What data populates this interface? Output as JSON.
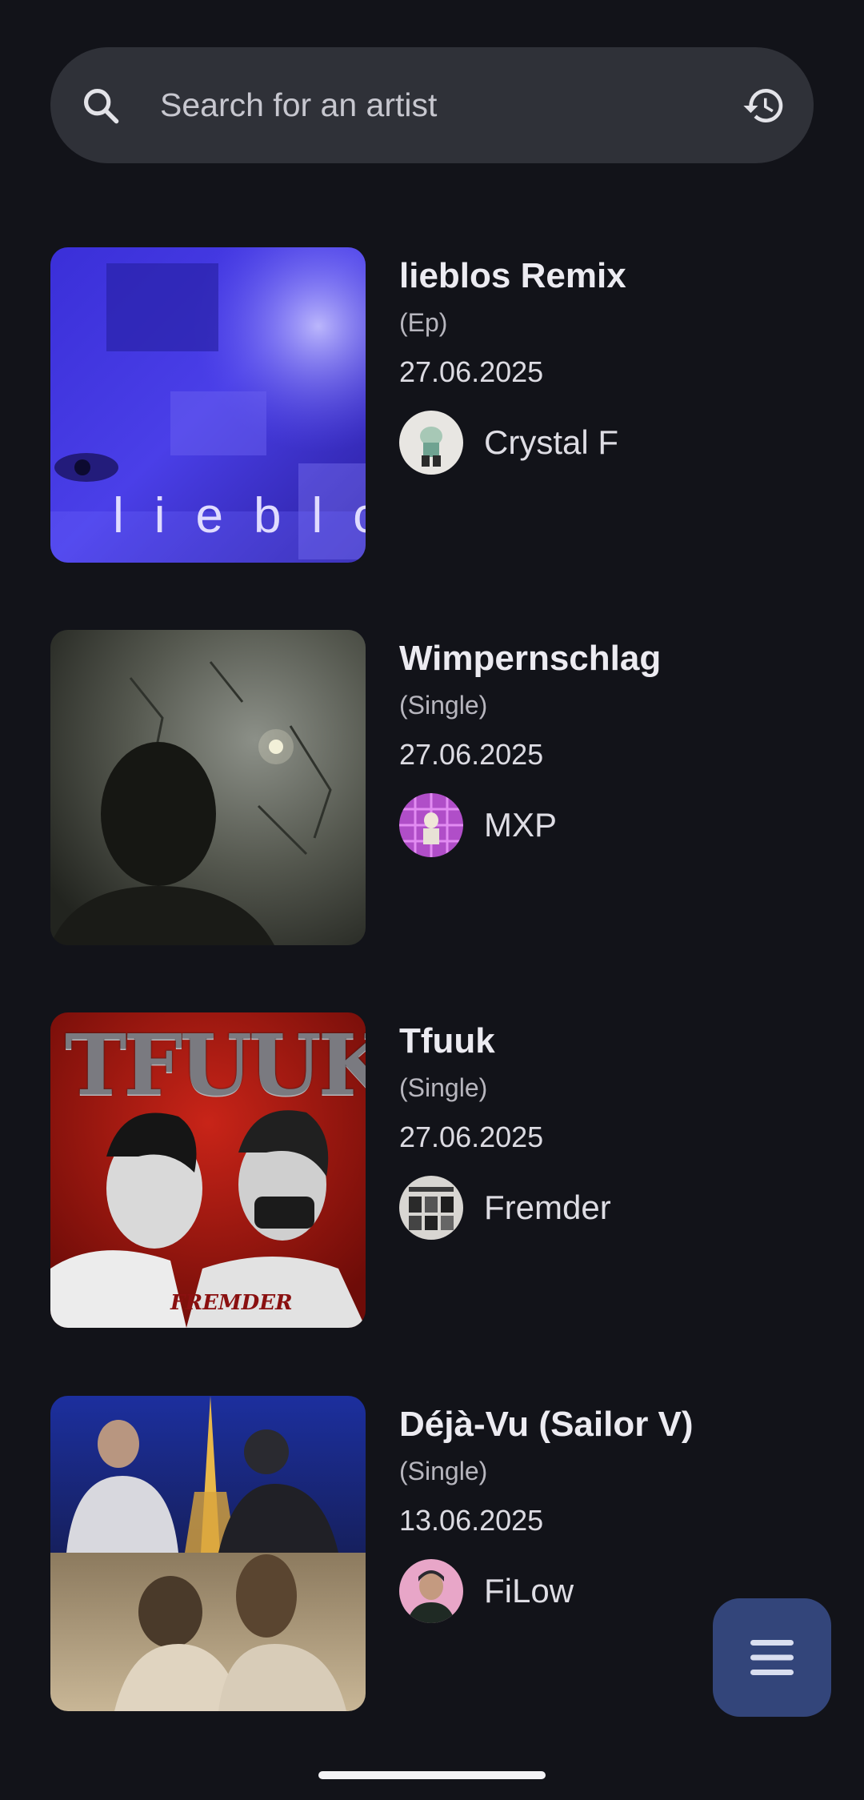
{
  "search": {
    "placeholder": "Search for an artist",
    "value": ""
  },
  "icons": {
    "search": "search-icon",
    "history": "history-icon",
    "menu": "menu-icon"
  },
  "colors": {
    "background": "#121319",
    "search_bar": "#2f3138",
    "fab": "#33457a"
  },
  "releases": [
    {
      "title": "lieblos Remix",
      "type": "(Ep)",
      "date": "27.06.2025",
      "artist": "Crystal F",
      "cover_text": "lieblos"
    },
    {
      "title": "Wimpernschlag",
      "type": "(Single)",
      "date": "27.06.2025",
      "artist": "MXP"
    },
    {
      "title": "Tfuuk",
      "type": "(Single)",
      "date": "27.06.2025",
      "artist": "Fremder",
      "cover_text": "TFUUK",
      "cover_subtext": "FREMDER"
    },
    {
      "title": "Déjà-Vu (Sailor V)",
      "type": "(Single)",
      "date": "13.06.2025",
      "artist": "FiLow"
    }
  ]
}
